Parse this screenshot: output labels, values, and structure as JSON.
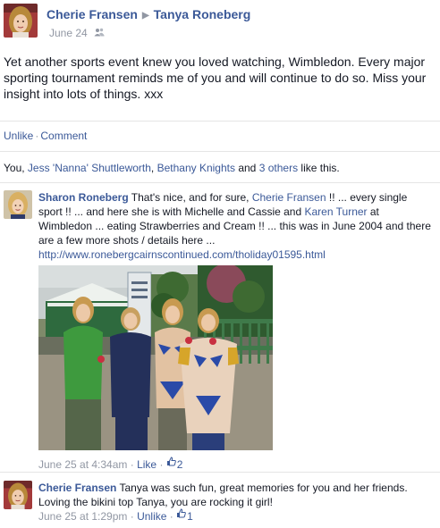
{
  "post": {
    "author": "Cherie Fransen",
    "recipient": "Tanya Roneberg",
    "date": "June 24",
    "privacy_icon": "friends-icon",
    "text": "Yet another sports event knew you loved watching, Wimbledon. Every major sporting tournament reminds me of you and will continue to do so. Miss your insight into lots of things. xxx"
  },
  "actions": {
    "unlike": "Unlike",
    "separator": "·",
    "comment": "Comment"
  },
  "likes": {
    "prefix": "You, ",
    "name1": "Jess 'Nanna' Shuttleworth",
    "comma": ", ",
    "name2": "Bethany Knights",
    "and": " and ",
    "others": "3 others",
    "suffix": " like this."
  },
  "comments": [
    {
      "author": "Sharon Roneberg",
      "t1": " That's nice, and for sure, ",
      "mention1": "Cherie Fransen",
      "t2": " !! ... every single sport !! ... and here she is with Michelle and Cassie and ",
      "mention2": "Karen Turner",
      "t3": " at Wimbledon ... eating Strawberries and Cream !! ... this was in June 2004 and there are a few more shots / details here ...",
      "url": "http://www.ronebergcairnscontinued.com/tholiday01595.html",
      "time": "June 25 at 4:34am",
      "sep": "·",
      "action": "Like",
      "sep2": "·",
      "like_count": "2"
    },
    {
      "author": "Cherie Fransen",
      "text": " Tanya was such fun, great memories for you and her friends. Loving the bikini top Tanya, you are rocking it girl!",
      "time": "June 25 at 1:29pm",
      "sep": "·",
      "action": "Unlike",
      "sep2": "·",
      "like_count": "1"
    }
  ],
  "colors": {
    "link": "#3b5998",
    "meta": "#9197a3",
    "text": "#141823",
    "divider": "#e5e5e5"
  }
}
